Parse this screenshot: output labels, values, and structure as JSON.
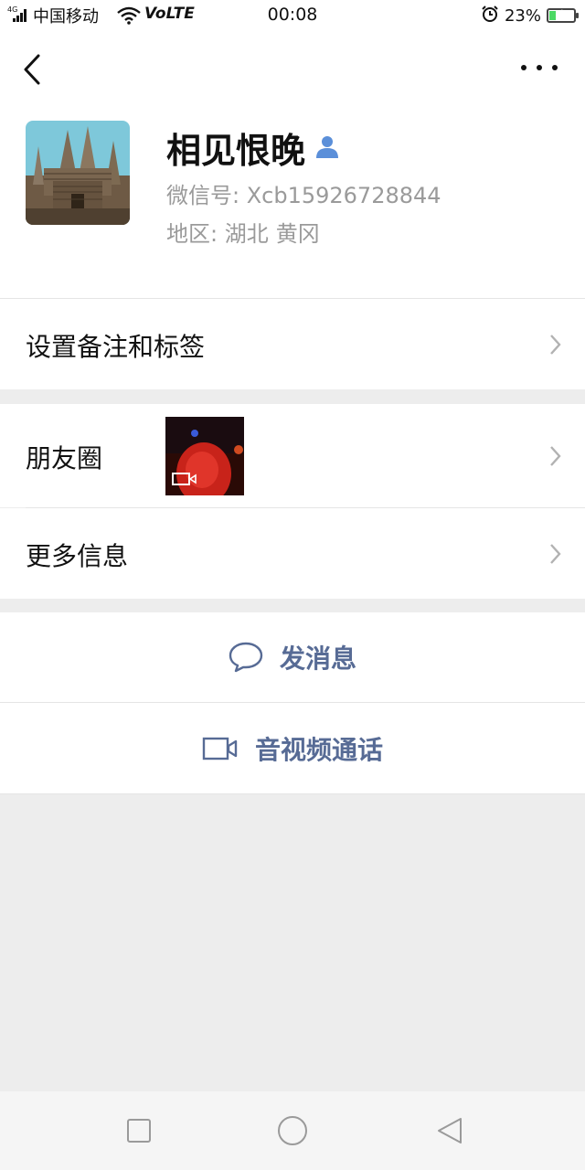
{
  "status_bar": {
    "network": "4G",
    "carrier": "中国移动",
    "volte": "VoLTE",
    "time": "00:08",
    "battery": "23%"
  },
  "profile": {
    "name": "相见恨晚",
    "wechat_id": "微信号: Xcb15926728844",
    "region_label": "地区: 湖北",
    "region_city": "黄冈"
  },
  "menu": {
    "remarks": "设置备注和标签",
    "moments": "朋友圈",
    "more_info": "更多信息"
  },
  "actions": {
    "message": "发消息",
    "call": "音视频通话"
  },
  "colors": {
    "accent": "#576b95",
    "background": "#ededed"
  }
}
